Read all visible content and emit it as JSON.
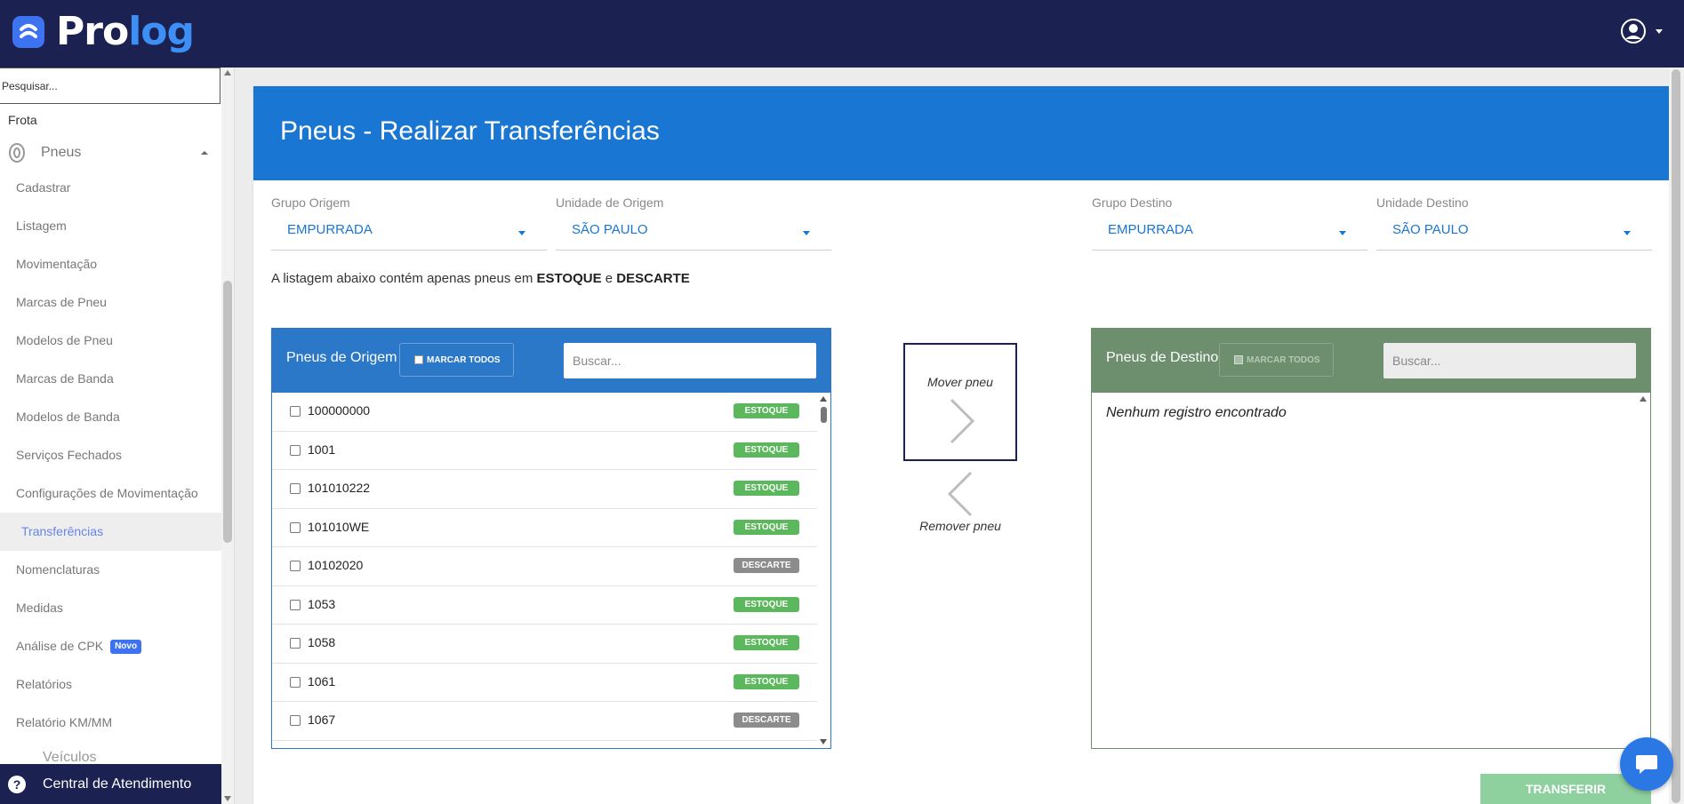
{
  "app": {
    "logo_text_1": "Pro",
    "logo_text_2": "log",
    "brand_color": "#1b2150",
    "accent_color": "#1976d2"
  },
  "sidebar": {
    "search_placeholder": "Pesquisar...",
    "section": "Frota",
    "group": {
      "label": "Pneus",
      "icon": "tire-icon"
    },
    "items": [
      {
        "label": "Cadastrar"
      },
      {
        "label": "Listagem"
      },
      {
        "label": "Movimentação"
      },
      {
        "label": "Marcas de Pneu"
      },
      {
        "label": "Modelos de Pneu"
      },
      {
        "label": "Marcas de Banda"
      },
      {
        "label": "Modelos de Banda"
      },
      {
        "label": "Serviços Fechados"
      },
      {
        "label": "Configurações de Movimentação"
      },
      {
        "label": "Transferências",
        "active": true
      },
      {
        "label": "Nomenclaturas"
      },
      {
        "label": "Medidas"
      },
      {
        "label": "Análise de CPK",
        "badge": "Novo"
      },
      {
        "label": "Relatórios"
      },
      {
        "label": "Relatório KM/MM"
      }
    ],
    "next_group": "Veículos",
    "help": "Central de Atendimento"
  },
  "page": {
    "title": "Pneus - Realizar Transferências",
    "origin_group": {
      "label": "Grupo Origem",
      "value": "EMPURRADA"
    },
    "origin_unit": {
      "label": "Unidade de Origem",
      "value": "SÃO PAULO"
    },
    "dest_group": {
      "label": "Grupo Destino",
      "value": "EMPURRADA"
    },
    "dest_unit": {
      "label": "Unidade Destino",
      "value": "SÃO PAULO"
    },
    "note_prefix": "A listagem abaixo contém apenas pneus em ",
    "note_bold_1": "ESTOQUE",
    "note_mid": " e ",
    "note_bold_2": "DESCARTE"
  },
  "origin_panel": {
    "title": "Pneus de Origem",
    "mark_all": "MARCAR TODOS",
    "search_placeholder": "Buscar...",
    "tires": [
      {
        "code": "100000000",
        "status": "ESTOQUE"
      },
      {
        "code": "1001",
        "status": "ESTOQUE"
      },
      {
        "code": "101010222",
        "status": "ESTOQUE"
      },
      {
        "code": "101010WE",
        "status": "ESTOQUE"
      },
      {
        "code": "10102020",
        "status": "DESCARTE"
      },
      {
        "code": "1053",
        "status": "ESTOQUE"
      },
      {
        "code": "1058",
        "status": "ESTOQUE"
      },
      {
        "code": "1061",
        "status": "ESTOQUE"
      },
      {
        "code": "1067",
        "status": "DESCARTE"
      }
    ]
  },
  "dest_panel": {
    "title": "Pneus de Destino",
    "mark_all": "MARCAR TODOS",
    "search_placeholder": "Buscar...",
    "empty": "Nenhum registro encontrado"
  },
  "controls": {
    "move": "Mover pneu",
    "remove": "Remover pneu",
    "transfer": "TRANSFERIR"
  }
}
